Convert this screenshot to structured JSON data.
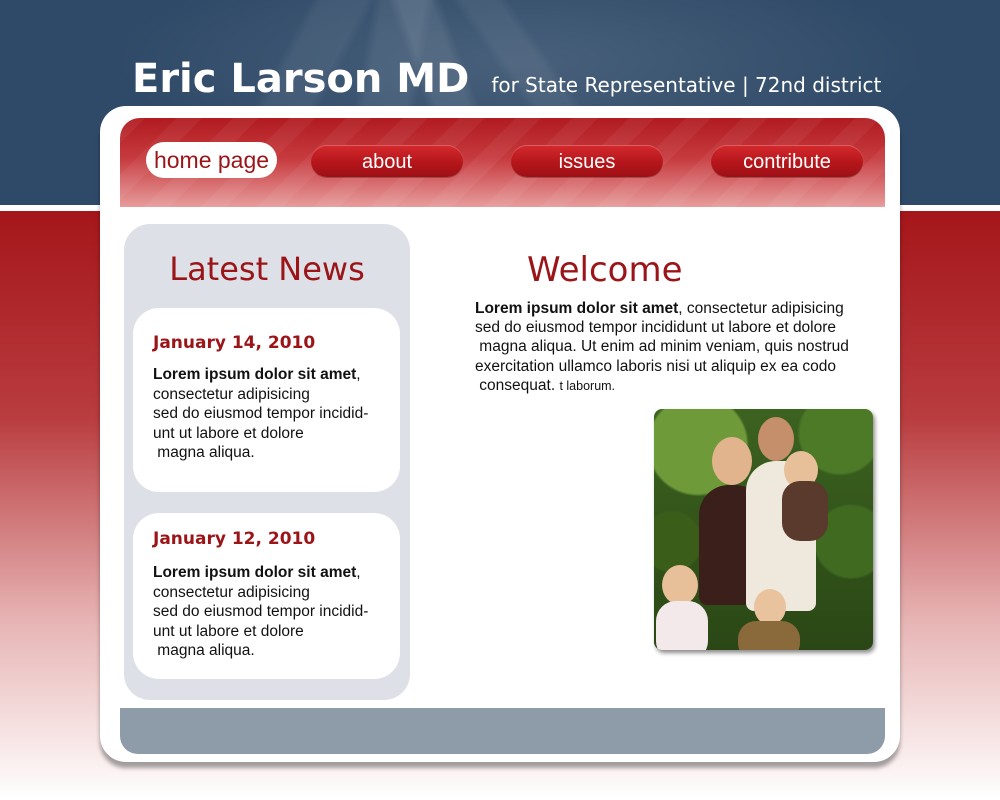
{
  "header": {
    "name": "Eric Larson MD",
    "tagline": "for State Representative | 72nd district"
  },
  "nav": {
    "items": [
      {
        "label": "home page",
        "active": true
      },
      {
        "label": "about",
        "active": false
      },
      {
        "label": "issues",
        "active": false
      },
      {
        "label": "contribute",
        "active": false
      }
    ]
  },
  "news": {
    "heading": "Latest News",
    "items": [
      {
        "date": "January 14, 2010",
        "lead": "Lorem ipsum dolor sit amet",
        "lead_suffix": ",",
        "lines": [
          "consectetur adipisicing",
          "sed do eiusmod tempor incidid-",
          "unt ut labore et dolore",
          " magna aliqua."
        ]
      },
      {
        "date": "January 12, 2010",
        "lead": "Lorem ipsum dolor sit amet",
        "lead_suffix": ",",
        "lines": [
          "consectetur adipisicing",
          "sed do eiusmod tempor incidid-",
          "unt ut labore et dolore",
          " magna aliqua."
        ]
      }
    ]
  },
  "welcome": {
    "heading": "Welcome",
    "lead": "Lorem ipsum dolor sit amet",
    "line1_rest": ", consectetur adipisicing",
    "line2": "sed do eiusmod tempor incididunt ut labore et dolore",
    "line3": " magna aliqua. Ut enim ad minim veniam, quis nostrud",
    "line4": "exercitation ullamco laboris nisi ut aliquip ex ea codo",
    "line5": " consequat. ",
    "line5_small": "t laborum."
  },
  "colors": {
    "header_blue": "#2f4a68",
    "brand_red": "#9a1418",
    "nav_red": "#b5161b",
    "news_panel": "#dde1e7",
    "footer_gray": "#8e9ba8"
  },
  "icons": {
    "photo": "family-photo"
  }
}
